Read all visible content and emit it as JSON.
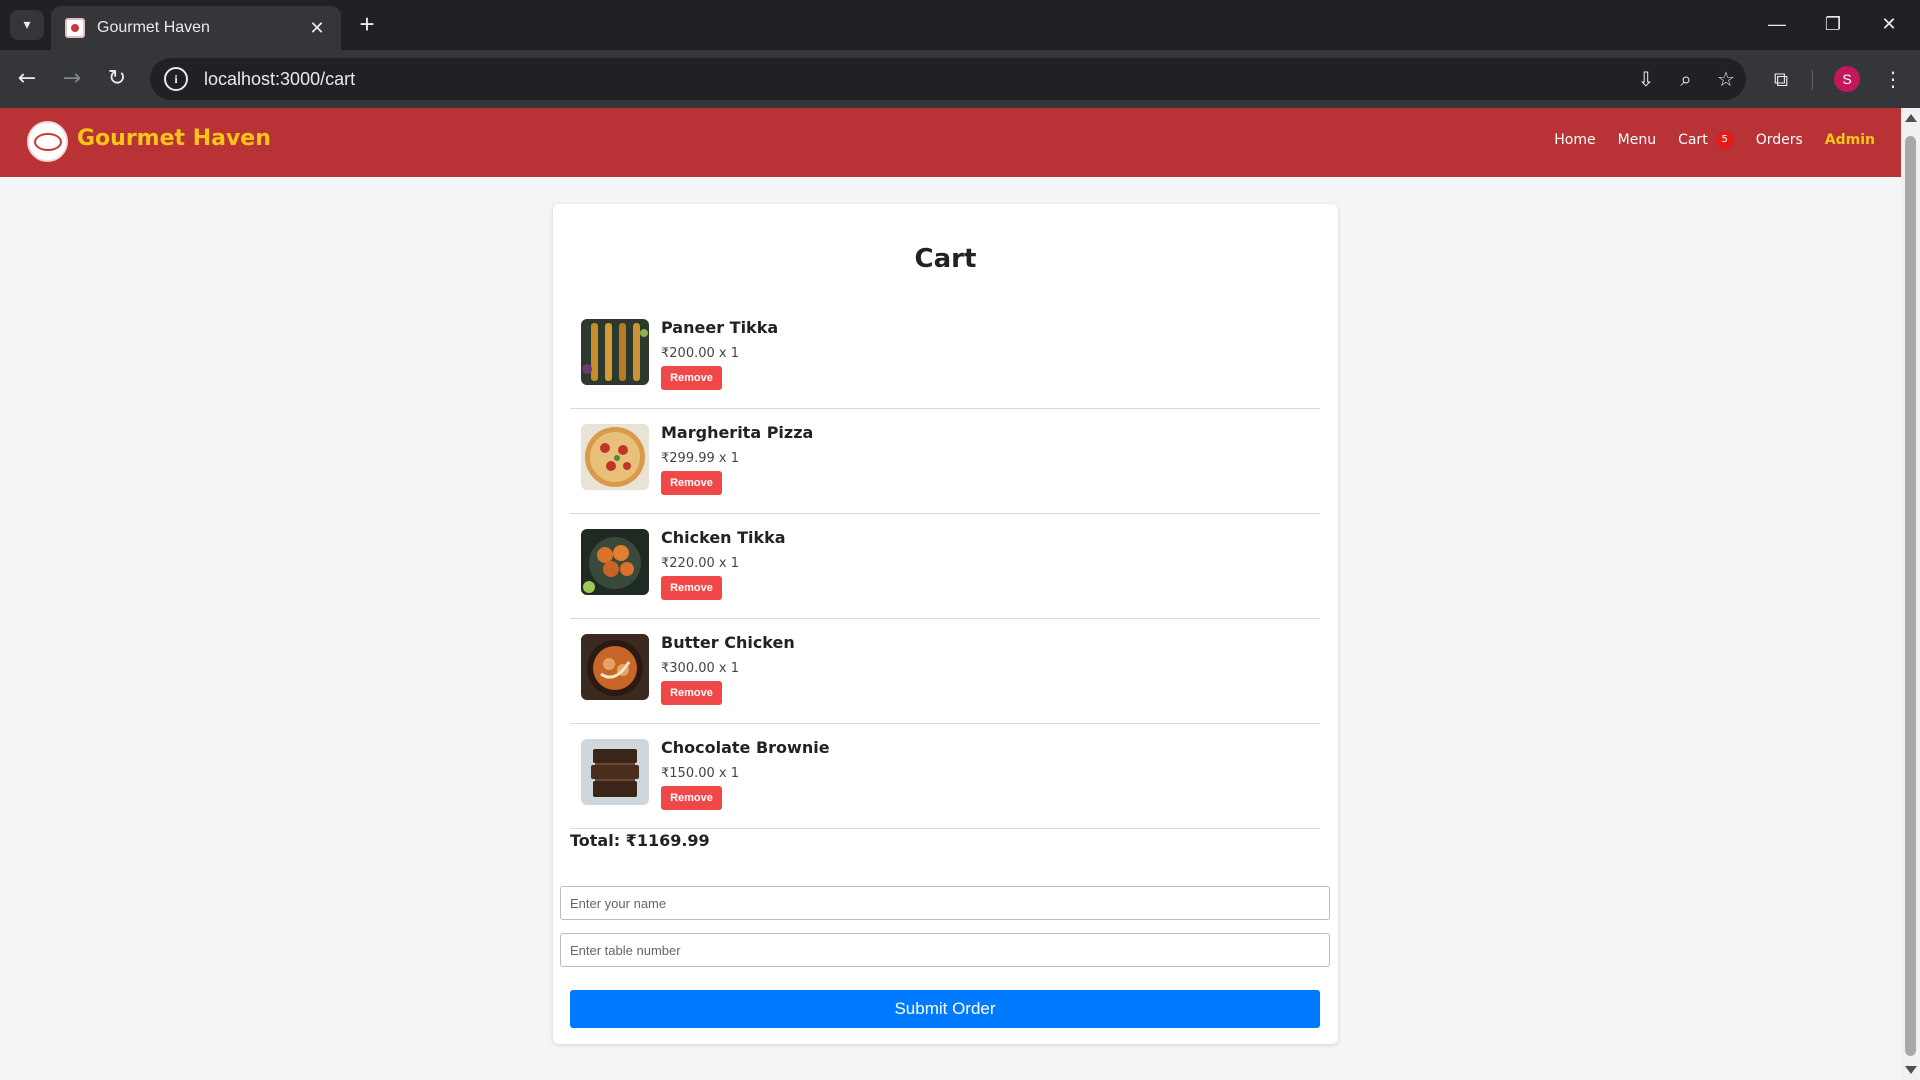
{
  "browser": {
    "tab_title": "Gourmet Haven",
    "url": "localhost:3000/cart",
    "profile_initial": "S"
  },
  "header": {
    "brand": "Gourmet Haven",
    "nav": {
      "home": "Home",
      "menu": "Menu",
      "cart": "Cart",
      "cart_count": "5",
      "orders": "Orders",
      "admin": "Admin"
    }
  },
  "cart": {
    "title": "Cart",
    "items": [
      {
        "name": "Paneer Tikka",
        "price_qty": "₹200.00 x 1",
        "remove_label": "Remove"
      },
      {
        "name": "Margherita Pizza",
        "price_qty": "₹299.99 x 1",
        "remove_label": "Remove"
      },
      {
        "name": "Chicken Tikka",
        "price_qty": "₹220.00 x 1",
        "remove_label": "Remove"
      },
      {
        "name": "Butter Chicken",
        "price_qty": "₹300.00 x 1",
        "remove_label": "Remove"
      },
      {
        "name": "Chocolate Brownie",
        "price_qty": "₹150.00 x 1",
        "remove_label": "Remove"
      }
    ],
    "total": "Total: ₹1169.99",
    "name_placeholder": "Enter your name",
    "table_placeholder": "Enter table number",
    "submit_label": "Submit Order"
  },
  "colors": {
    "header_bg": "#b93235",
    "brand": "#f5c518",
    "remove": "#f04848",
    "submit": "#007bff",
    "badge": "#e21b1b"
  }
}
